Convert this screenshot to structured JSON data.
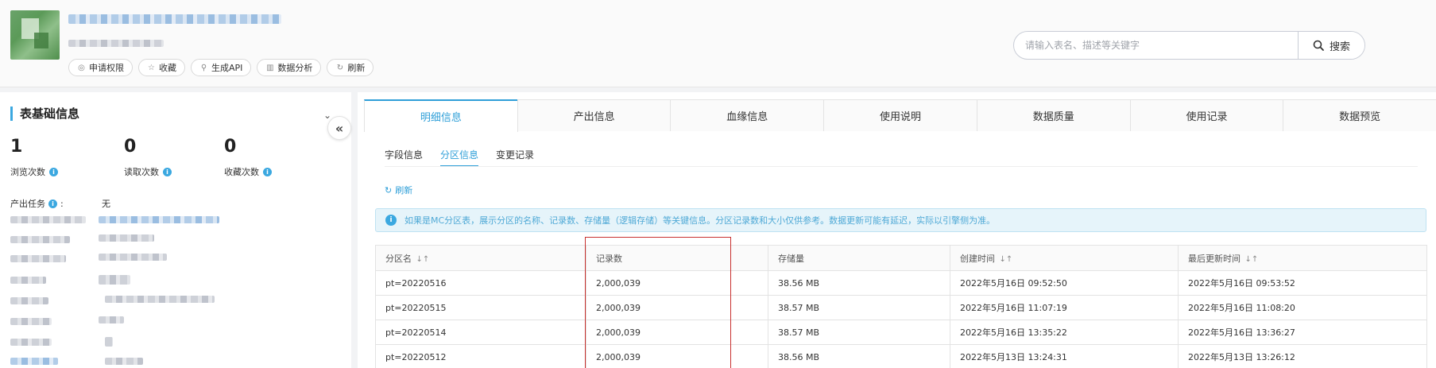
{
  "header": {
    "actions": [
      {
        "icon": "◎",
        "label": "申请权限"
      },
      {
        "icon": "☆",
        "label": "收藏"
      },
      {
        "icon": "⚲",
        "label": "生成API"
      },
      {
        "icon": "▥",
        "label": "数据分析"
      },
      {
        "icon": "↻",
        "label": "刷新"
      }
    ],
    "search": {
      "placeholder": "请输入表名、描述等关键字",
      "button_label": "搜索"
    }
  },
  "left_panel": {
    "title": "表基础信息",
    "stats": [
      {
        "value": "1",
        "label": "浏览次数"
      },
      {
        "value": "0",
        "label": "读取次数"
      },
      {
        "value": "0",
        "label": "收藏次数"
      }
    ],
    "output_task": {
      "label": "产出任务",
      "value": "无"
    }
  },
  "main": {
    "tabs": [
      "明细信息",
      "产出信息",
      "血缘信息",
      "使用说明",
      "数据质量",
      "使用记录",
      "数据预览"
    ],
    "active_tab": 0,
    "subtabs": [
      "字段信息",
      "分区信息",
      "变更记录"
    ],
    "active_subtab": 1,
    "refresh_label": "刷新",
    "notice": "如果是MC分区表，展示分区的名称、记录数、存储量（逻辑存储）等关键信息。分区记录数和大小仅供参考。数据更新可能有延迟，实际以引擎侧为准。",
    "table": {
      "columns": [
        "分区名",
        "记录数",
        "存储量",
        "创建时间",
        "最后更新时间"
      ],
      "rows": [
        [
          "pt=20220516",
          "2,000,039",
          "38.56 MB",
          "2022年5月16日 09:52:50",
          "2022年5月16日 09:53:52"
        ],
        [
          "pt=20220515",
          "2,000,039",
          "38.57 MB",
          "2022年5月16日 11:07:19",
          "2022年5月16日 11:08:20"
        ],
        [
          "pt=20220514",
          "2,000,039",
          "38.57 MB",
          "2022年5月16日 13:35:22",
          "2022年5月16日 13:36:27"
        ],
        [
          "pt=20220512",
          "2,000,039",
          "38.56 MB",
          "2022年5月13日 13:24:31",
          "2022年5月13日 13:26:12"
        ]
      ]
    }
  },
  "colors": {
    "accent": "#2f9fd8",
    "notice_bg": "#e6f4fa",
    "highlight": "#c8312f"
  }
}
